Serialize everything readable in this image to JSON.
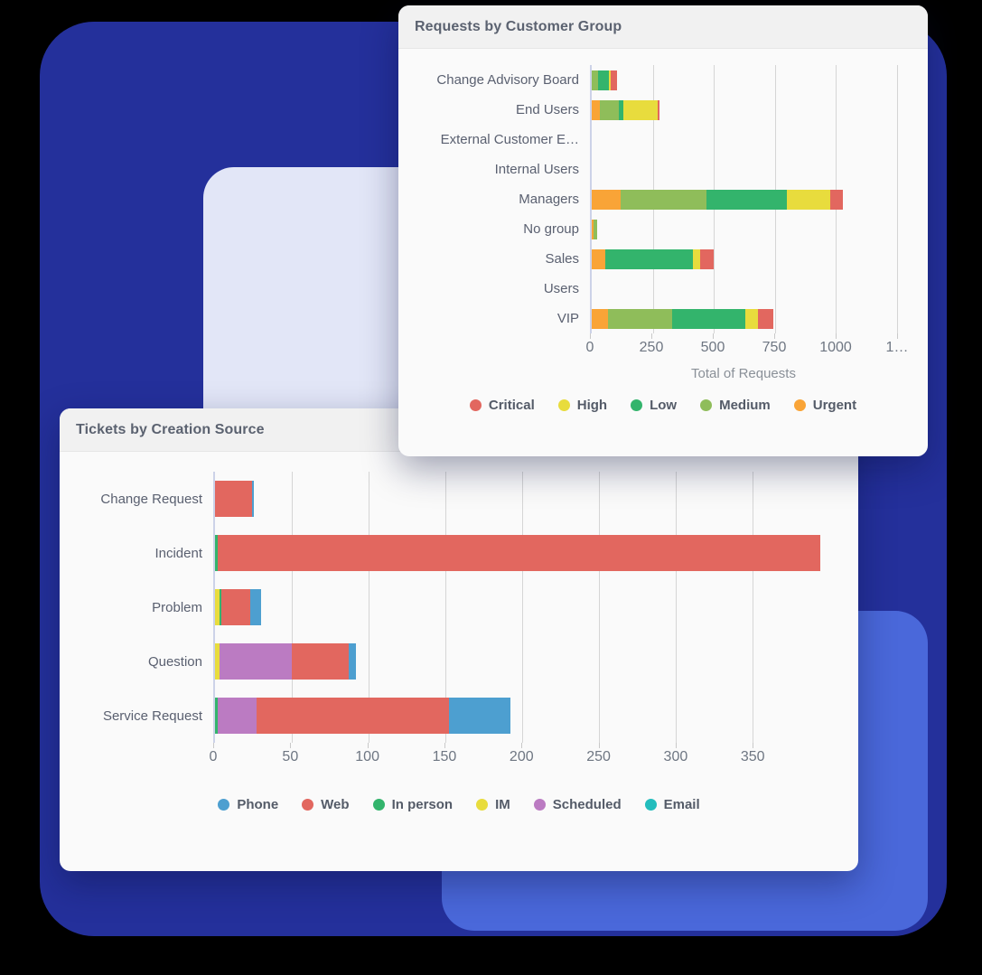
{
  "background": {
    "navy_color": "#24309b",
    "lavender_color": "#e2e6f7",
    "royal_color": "#4a68da",
    "page_color": "#000000"
  },
  "cards": [
    {
      "id": "requests",
      "title": "Requests by Customer Group"
    },
    {
      "id": "tickets",
      "title": "Tickets by Creation Source"
    }
  ],
  "chart_data": [
    {
      "type": "bar",
      "orientation": "horizontal",
      "stacked": true,
      "title": "Requests by Customer Group",
      "xlabel": "Total of Requests",
      "ylabel": "",
      "xlim": [
        0,
        1250
      ],
      "xticks": [
        0,
        250,
        500,
        750,
        1000,
        1250
      ],
      "xtick_labels": [
        "0",
        "250",
        "500",
        "750",
        "1000",
        "1…"
      ],
      "grid": true,
      "legend_position": "bottom",
      "categories": [
        "Change Advisory Board",
        "End Users",
        "External Customer E…",
        "Internal Users",
        "Managers",
        "No group",
        "Sales",
        "Users",
        "VIP"
      ],
      "series": [
        {
          "name": "Critical",
          "color": "#e2675f",
          "values": [
            25,
            8,
            0,
            0,
            55,
            0,
            55,
            0,
            65
          ]
        },
        {
          "name": "High",
          "color": "#e8dc3d",
          "values": [
            8,
            140,
            0,
            0,
            175,
            0,
            30,
            0,
            50
          ]
        },
        {
          "name": "Low",
          "color": "#33b46c",
          "values": [
            45,
            20,
            0,
            0,
            330,
            0,
            360,
            0,
            300
          ]
        },
        {
          "name": "Medium",
          "color": "#8fbd5a",
          "values": [
            25,
            75,
            0,
            0,
            350,
            14,
            0,
            0,
            265
          ]
        },
        {
          "name": "Urgent",
          "color": "#f9a437",
          "values": [
            0,
            35,
            0,
            0,
            120,
            8,
            55,
            0,
            65
          ]
        }
      ],
      "stack_order": [
        "Urgent",
        "Medium",
        "Low",
        "High",
        "Critical"
      ],
      "legend": [
        {
          "label": "Critical",
          "color": "#e2675f"
        },
        {
          "label": "High",
          "color": "#e8dc3d"
        },
        {
          "label": "Low",
          "color": "#33b46c"
        },
        {
          "label": "Medium",
          "color": "#8fbd5a"
        },
        {
          "label": "Urgent",
          "color": "#f9a437"
        }
      ]
    },
    {
      "type": "bar",
      "orientation": "horizontal",
      "stacked": true,
      "title": "Tickets by Creation Source",
      "xlabel": "",
      "ylabel": "",
      "xlim": [
        0,
        395
      ],
      "xticks": [
        0,
        50,
        100,
        150,
        200,
        250,
        300,
        350
      ],
      "xtick_labels": [
        "0",
        "50",
        "100",
        "150",
        "200",
        "250",
        "300",
        "350"
      ],
      "grid": true,
      "legend_position": "bottom",
      "categories": [
        "Change Request",
        "Incident",
        "Problem",
        "Question",
        "Service Request"
      ],
      "series": [
        {
          "name": "Phone",
          "color": "#4d9fd0",
          "values": [
            1,
            0,
            7,
            5,
            40
          ]
        },
        {
          "name": "Web",
          "color": "#e2675f",
          "values": [
            24,
            392,
            19,
            37,
            125
          ]
        },
        {
          "name": "In person",
          "color": "#33b46c",
          "values": [
            0,
            2,
            1,
            0,
            2
          ]
        },
        {
          "name": "IM",
          "color": "#e8dc3d",
          "values": [
            0,
            0,
            3,
            3,
            0
          ]
        },
        {
          "name": "Scheduled",
          "color": "#bb7bc2",
          "values": [
            0,
            0,
            0,
            47,
            25
          ]
        },
        {
          "name": "Email",
          "color": "#23bdbd",
          "values": [
            0,
            0,
            0,
            0,
            0
          ]
        }
      ],
      "stack_order": [
        "IM",
        "In person",
        "Scheduled",
        "Web",
        "Phone",
        "Email"
      ],
      "legend": [
        {
          "label": "Phone",
          "color": "#4d9fd0"
        },
        {
          "label": "Web",
          "color": "#e2675f"
        },
        {
          "label": "In person",
          "color": "#33b46c"
        },
        {
          "label": "IM",
          "color": "#e8dc3d"
        },
        {
          "label": "Scheduled",
          "color": "#bb7bc2"
        },
        {
          "label": "Email",
          "color": "#23bdbd"
        }
      ]
    }
  ]
}
